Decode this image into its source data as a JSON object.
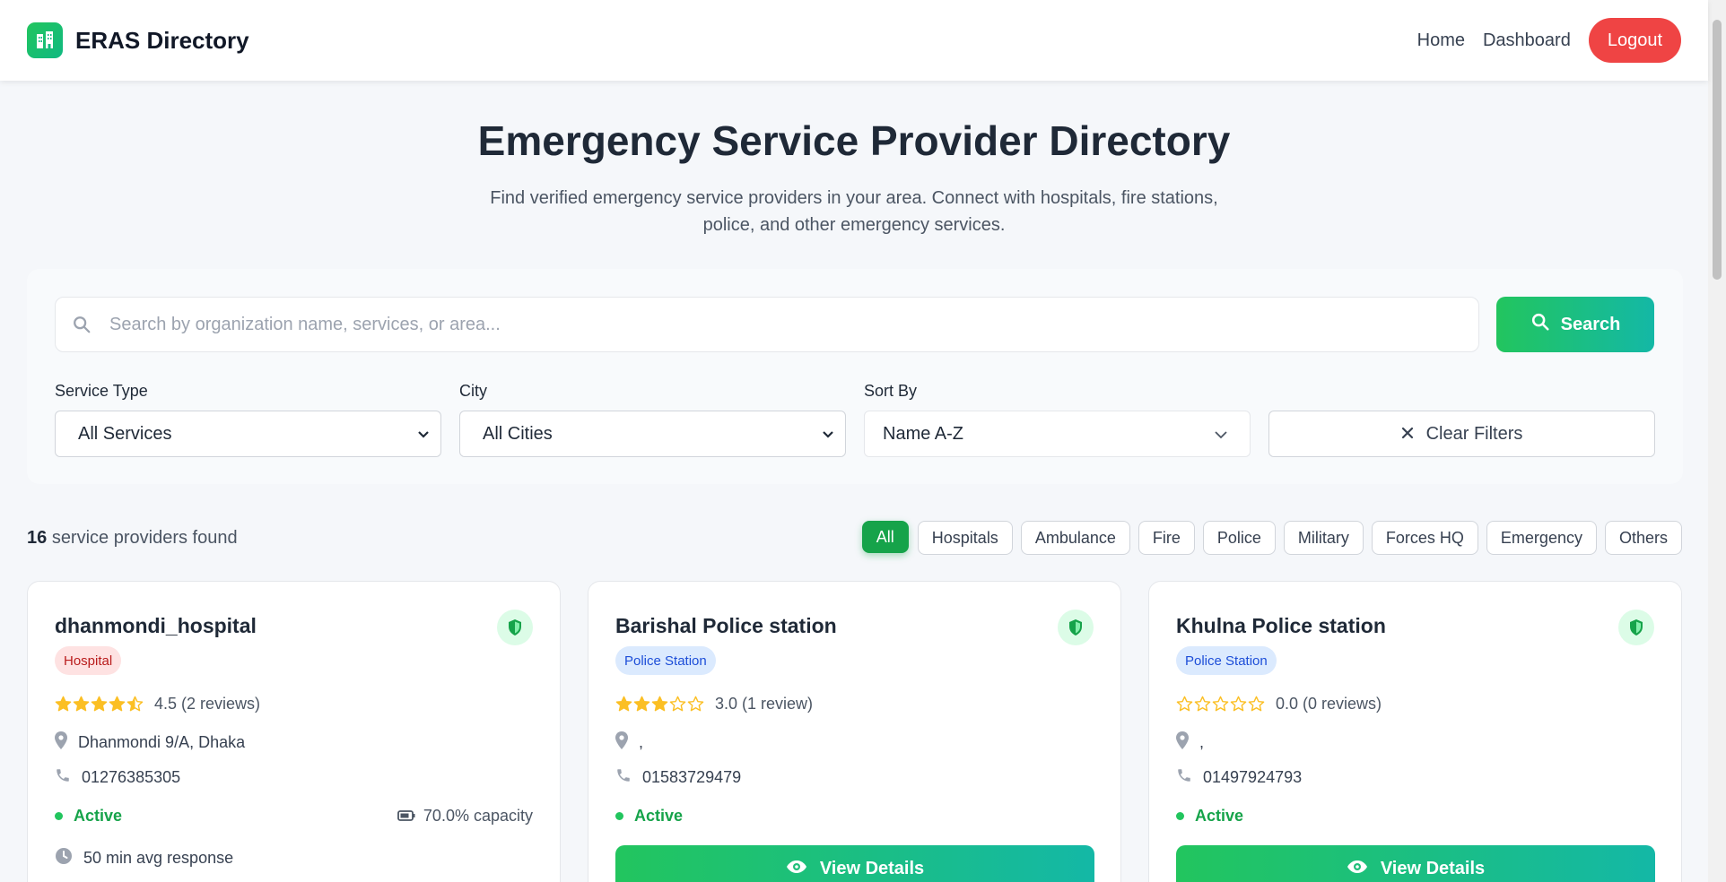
{
  "app": {
    "brand_name": "ERAS Directory",
    "accent_color": "#22c55e",
    "danger_color": "#ef4444"
  },
  "nav": {
    "home_label": "Home",
    "dashboard_label": "Dashboard",
    "logout_label": "Logout"
  },
  "hero": {
    "title": "Emergency Service Provider Directory",
    "subtitle": "Find verified emergency service providers in your area. Connect with hospitals, fire stations, police, and other emergency services."
  },
  "search": {
    "placeholder": "Search by organization name, services, or area...",
    "button_label": "Search"
  },
  "filters": {
    "service_type_label": "Service Type",
    "service_type_value": "All Services",
    "city_label": "City",
    "city_value": "All Cities",
    "sort_label": "Sort By",
    "sort_value": "Name A-Z",
    "clear_label": "Clear Filters"
  },
  "results": {
    "count": "16",
    "suffix": "service providers found"
  },
  "chips": [
    "All",
    "Hospitals",
    "Ambulance",
    "Fire",
    "Police",
    "Military",
    "Forces HQ",
    "Emergency",
    "Others"
  ],
  "cards": [
    {
      "name": "dhanmondi_hospital",
      "type": "Hospital",
      "rating": 4.5,
      "rating_text": "4.5 (2 reviews)",
      "location": "Dhanmondi 9/A, Dhaka",
      "phone": "01276385305",
      "status": "Active",
      "capacity": "70.0% capacity",
      "response": "50 min avg response"
    },
    {
      "name": "Barishal Police station",
      "type": "Police Station",
      "rating": 3.0,
      "rating_text": "3.0 (1 review)",
      "location": ",",
      "phone": "01583729479",
      "status": "Active",
      "button_label": "View Details"
    },
    {
      "name": "Khulna Police station",
      "type": "Police Station",
      "rating": 0.0,
      "rating_text": "0.0 (0 reviews)",
      "location": ",",
      "phone": "01497924793",
      "status": "Active",
      "button_label": "View Details"
    }
  ]
}
